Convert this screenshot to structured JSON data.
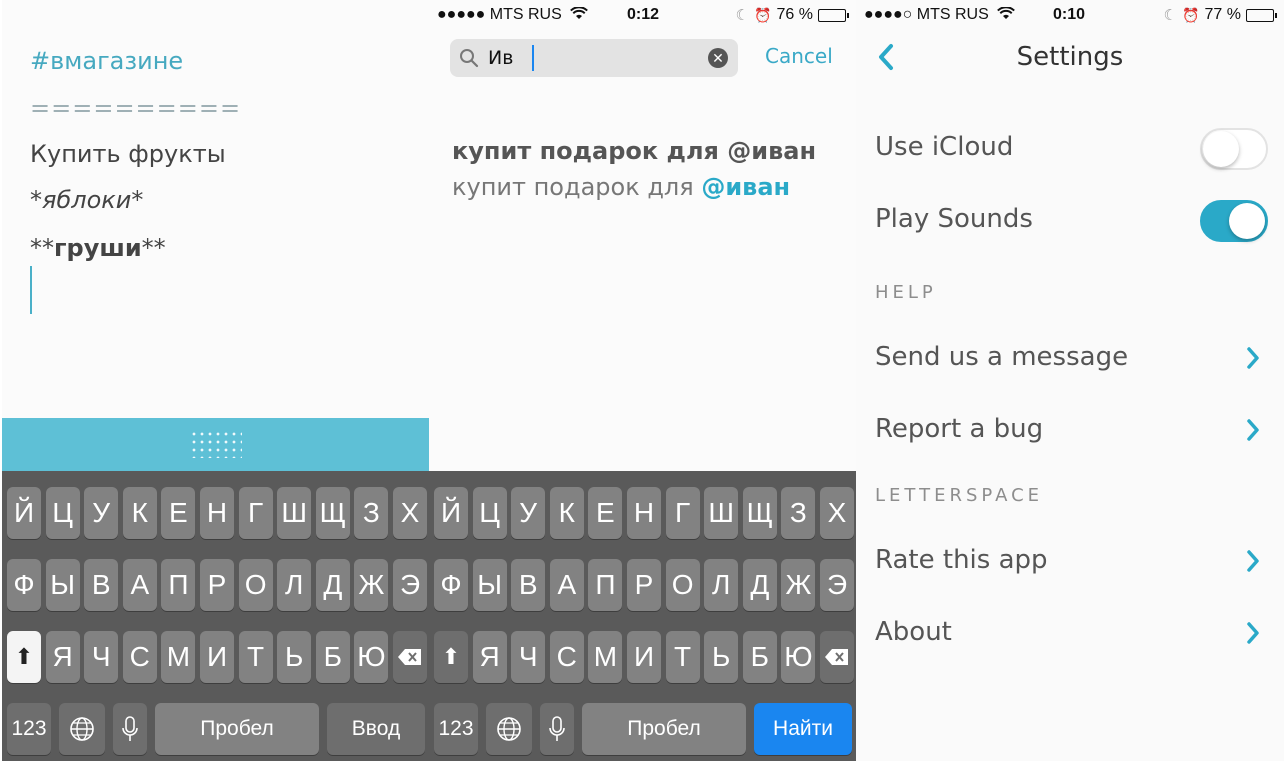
{
  "editor": {
    "hashtag": "#вмагазине",
    "rule": "==========",
    "line1": "Купить фрукты",
    "line2": "*яблоки*",
    "line3_prefix": "**",
    "line3_bold": "груши",
    "line3_suffix": "**"
  },
  "keyboard": {
    "row1": [
      "Й",
      "Ц",
      "У",
      "К",
      "Е",
      "Н",
      "Г",
      "Ш",
      "Щ",
      "З",
      "Х"
    ],
    "row2": [
      "Ф",
      "Ы",
      "В",
      "А",
      "П",
      "Р",
      "О",
      "Л",
      "Д",
      "Ж",
      "Э"
    ],
    "row3": [
      "Я",
      "Ч",
      "С",
      "М",
      "И",
      "Т",
      "Ь",
      "Б",
      "Ю"
    ],
    "numbers_label": "123",
    "space_label": "Пробел",
    "return_label": "Ввод",
    "search_label": "Найти"
  },
  "search_screen": {
    "status": {
      "carrier": "●●●●● MTS RUS",
      "time": "0:12",
      "battery": "76 %",
      "battery_level": 0.76
    },
    "query": "Ив",
    "cancel_label": "Cancel",
    "result_title": "купит подарок для @иван",
    "result_sub_prefix": "купит подарок для ",
    "result_sub_mention": "@иван"
  },
  "settings_screen": {
    "status": {
      "carrier": "●●●●○ MTS RUS",
      "time": "0:10",
      "battery": "77 %",
      "battery_level": 0.77
    },
    "title": "Settings",
    "use_icloud_label": "Use iCloud",
    "use_icloud_on": false,
    "play_sounds_label": "Play Sounds",
    "play_sounds_on": true,
    "help_header": "HELP",
    "send_message_label": "Send us a message",
    "report_bug_label": "Report a bug",
    "letterspace_header": "LETTERSPACE",
    "rate_label": "Rate this app",
    "about_label": "About"
  },
  "colors": {
    "accent": "#2aa9c8",
    "handle_bar": "#5ec0d6",
    "keyboard_bg": "#5a5a5a",
    "key": "#828282",
    "search_key": "#1a86f0"
  }
}
